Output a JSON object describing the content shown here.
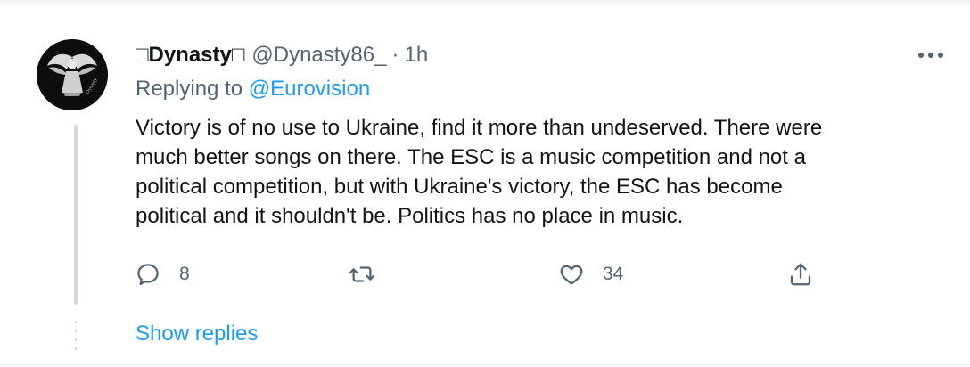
{
  "tweet": {
    "display_name": "□Dynasty□",
    "handle": "@Dynasty86_",
    "separator": "·",
    "time": "1h",
    "reply_prefix": "Replying to ",
    "reply_to": "@Eurovision",
    "text_lines": [
      "Victory is of no use to Ukraine, find it more than undeserved. There were",
      "much better songs on there. The ESC is a music competition and not a",
      "political competition, but with Ukraine's victory, the ESC has become",
      "political and it shouldn't be. Politics has no place in music."
    ],
    "avatar_caption": "Dynasty"
  },
  "actions": {
    "reply_count": "8",
    "retweet_count": "",
    "like_count": "34"
  },
  "thread": {
    "show_replies_label": "Show replies"
  },
  "icons": {
    "more": "more-icon",
    "reply": "reply-icon",
    "retweet": "retweet-icon",
    "like": "heart-icon",
    "share": "share-icon"
  },
  "colors": {
    "text": "#0f1419",
    "muted": "#536471",
    "link": "#1d9bf0",
    "thread_line": "#cfd9de"
  }
}
